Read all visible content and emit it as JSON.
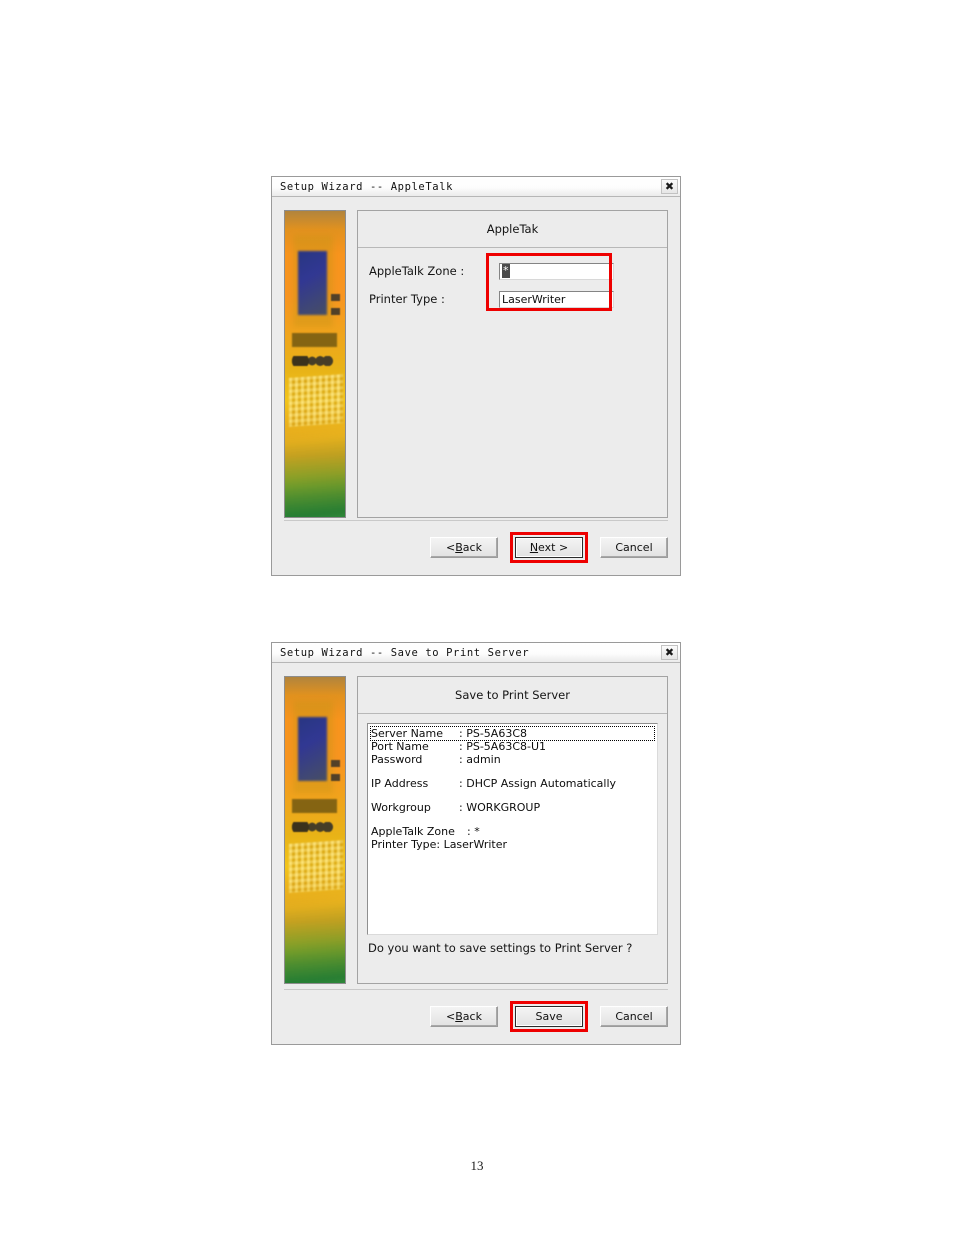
{
  "page": {
    "number": "13"
  },
  "dialog_appletalk": {
    "titlebar": {
      "title": "Setup Wizard -- AppleTalk",
      "close_icon": "close-icon",
      "close_glyph": "✖"
    },
    "pane_header": "AppleTak",
    "fields": [
      {
        "label": "AppleTalk Zone :",
        "value": "*",
        "selected": true
      },
      {
        "label": "Printer Type :",
        "value": "LaserWriter",
        "selected": false
      }
    ],
    "buttons": {
      "back": "< Back",
      "back_mnemonic": "B",
      "next": "Next >",
      "next_mnemonic": "N",
      "cancel": "Cancel",
      "highlighted": "Next >"
    },
    "highlight_color": "#ee0000"
  },
  "dialog_save": {
    "titlebar": {
      "title": "Setup Wizard -- Save to Print Server",
      "close_icon": "close-icon",
      "close_glyph": "✖"
    },
    "pane_header": "Save to Print Server",
    "summary": [
      {
        "key": "Server Name",
        "sep": ":",
        "value": "PS-5A63C8",
        "focused": true
      },
      {
        "key": "Port Name",
        "sep": ":",
        "value": "PS-5A63C8-U1",
        "focused": false
      },
      {
        "key": "Password",
        "sep": ":",
        "value": "admin",
        "focused": false
      },
      {
        "key": "IP Address",
        "sep": ":",
        "value": "DHCP Assign Automatically",
        "focused": false
      },
      {
        "key": "Workgroup",
        "sep": ":",
        "value": "WORKGROUP",
        "focused": false
      },
      {
        "key": "AppleTalk Zone",
        "sep": ":",
        "value": "*",
        "focused": false
      },
      {
        "key": "Printer Type:",
        "sep": "",
        "value": "LaserWriter",
        "focused": false
      }
    ],
    "prompt": "Do you want to save settings to Print Server ?",
    "buttons": {
      "back": "< Back",
      "back_mnemonic": "B",
      "save": "Save",
      "cancel": "Cancel",
      "highlighted": "Save"
    },
    "highlight_color": "#ee0000"
  }
}
